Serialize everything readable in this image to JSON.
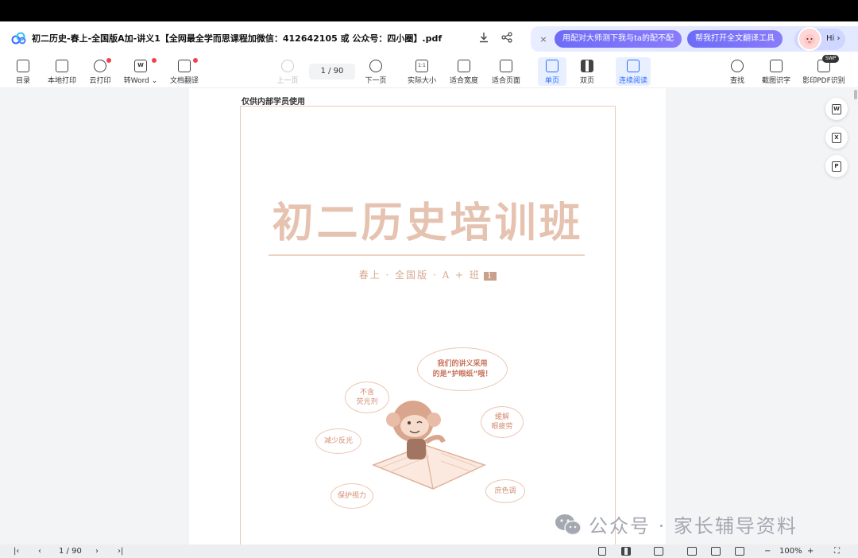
{
  "window": {
    "title": "初二历史-春上-全国版A加-讲义1【全网最全学而思课程加微信：412642105 或 公众号：四小圈】.pdf"
  },
  "promo": {
    "btn1": "用配对大师测下我与ta的配不配",
    "btn2": "帮我打开全文翻译工具",
    "hi": "Hi ›",
    "close": "×"
  },
  "toolbar": {
    "toc": "目录",
    "local_print": "本地打印",
    "cloud_print": "云打印",
    "to_word": "转Word ⌄",
    "translate": "文档翻译",
    "prev_page": "上一页",
    "page_indicator": "1 / 90",
    "next_page": "下一页",
    "actual_size": "实际大小",
    "fit_width": "适合宽度",
    "fit_page": "适合页面",
    "single_page": "单页",
    "double_page": "双页",
    "continuous": "连续阅读",
    "find": "查找",
    "screenshot_ocr": "截图识字",
    "pdf_ocr": "影印PDF识别",
    "swp_badge": "SWP"
  },
  "document": {
    "internal_note": "仅供内部学员使用",
    "main_title": "初二历史培训班",
    "subtitle": "春上 · 全国版 · A + 班",
    "subtitle_num": "1",
    "bubbles": {
      "main": "我们的讲义采用\n的是“护眼纸”哦！",
      "no_fluorescent": "不含\n荧光剂",
      "relieve": "缓解\n眼疲劳",
      "reduce_glare": "减少反光",
      "protect_eyes": "保护视力",
      "color": "庶色调"
    }
  },
  "float_tools": [
    "W",
    "X",
    "P"
  ],
  "watermark": "公众号 · 家长辅导资料",
  "statusbar": {
    "page_indicator": "1 / 90",
    "zoom": "100%",
    "zoom_out": "−",
    "zoom_in": "+"
  }
}
